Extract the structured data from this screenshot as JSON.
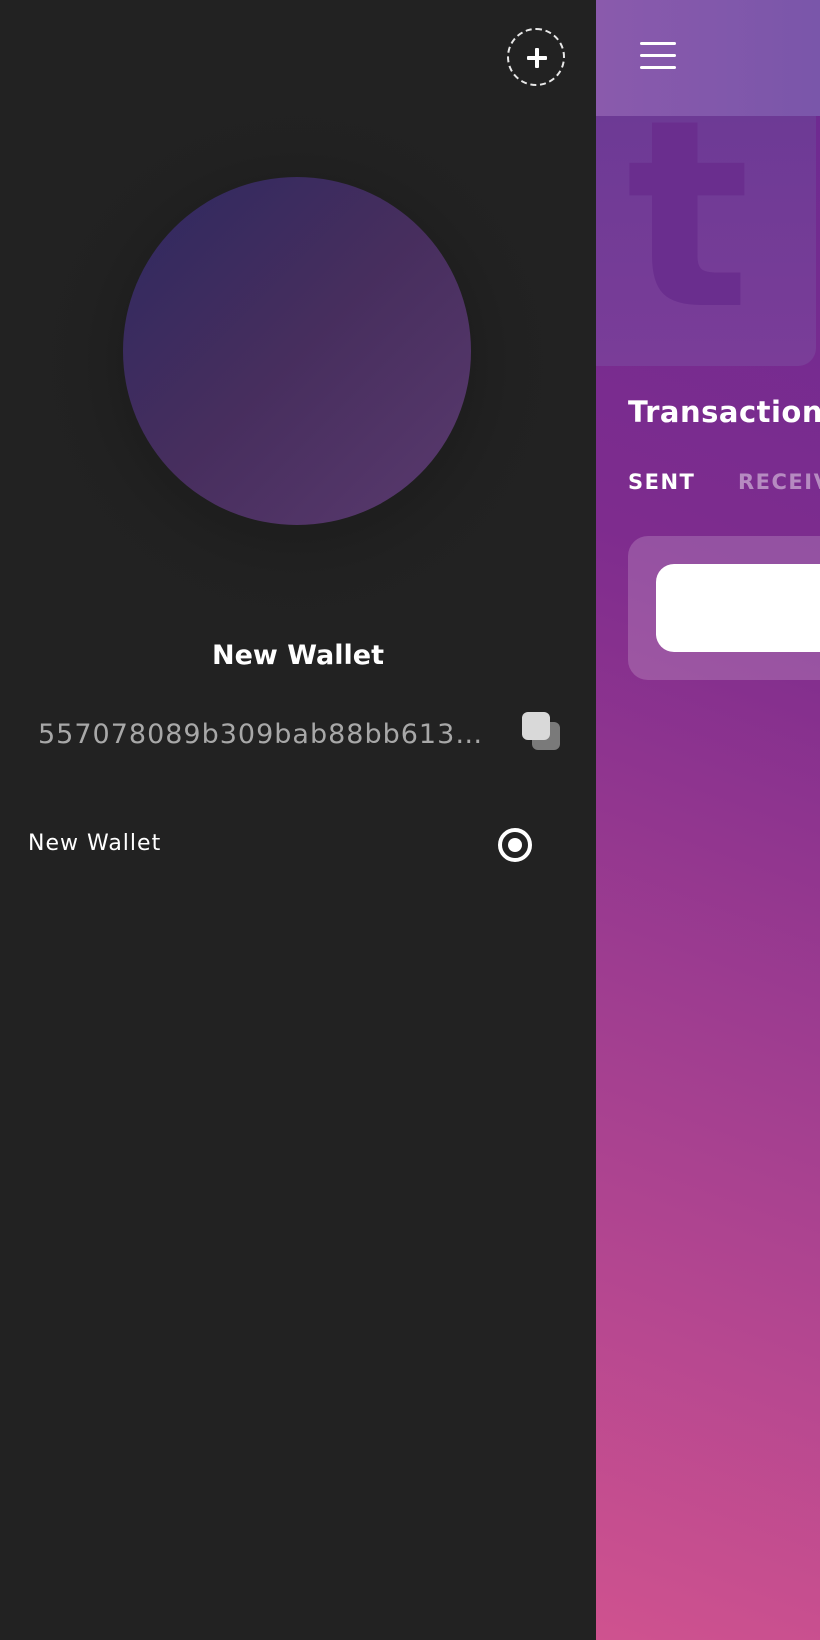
{
  "drawer": {
    "add_button_icon": "plus-icon",
    "wallet_name": "New Wallet",
    "wallet_address": "557078089b309bab88bb613d...",
    "copy_icon": "copy-icon",
    "wallets": [
      {
        "label": "New Wallet",
        "selected": true
      }
    ]
  },
  "main": {
    "menu_icon": "hamburger-menu-icon",
    "logo_letter": "t",
    "title": "Transactions",
    "tabs": [
      {
        "label": "SENT",
        "active": true
      },
      {
        "label": "RECEIVED",
        "active": false
      }
    ]
  },
  "colors": {
    "drawer_bg": "#222222",
    "accent_purple": "#7e2c8e",
    "accent_pink": "#cf528f"
  }
}
